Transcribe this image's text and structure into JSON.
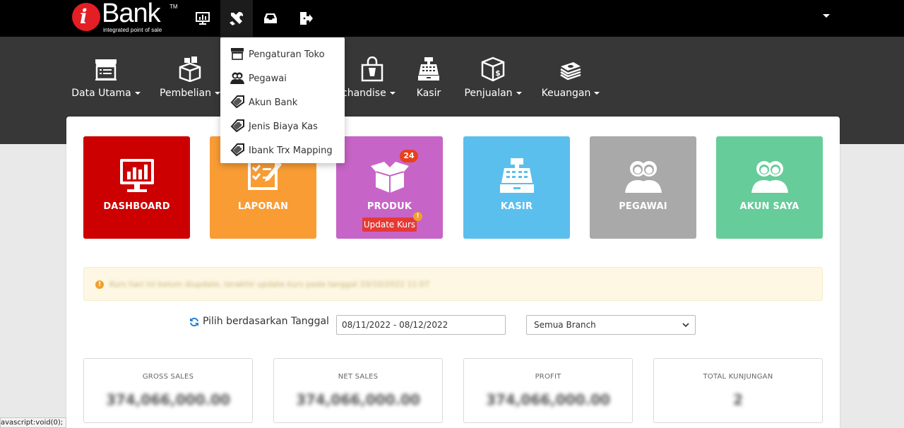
{
  "brand": {
    "name": "Bank",
    "tm": "TM",
    "tagline": "integrated point of sale"
  },
  "topbar": {
    "icons": [
      "monitor-chart-icon",
      "tools-icon",
      "inbox-icon",
      "logout-icon"
    ],
    "active": "tools-icon"
  },
  "menu": [
    {
      "label": "Data Utama",
      "icon": "store-icon",
      "caret": true
    },
    {
      "label": "Pembelian",
      "icon": "boxes-icon",
      "caret": true
    },
    {
      "label": "chandise",
      "icon": "shopping-bag-icon",
      "caret": true
    },
    {
      "label": "Kasir",
      "icon": "cash-register-icon",
      "caret": false
    },
    {
      "label": "Penjualan",
      "icon": "dollar-box-icon",
      "caret": true
    },
    {
      "label": "Keuangan",
      "icon": "money-stack-icon",
      "caret": true
    }
  ],
  "dropdown": {
    "items": [
      {
        "label": "Pengaturan Toko",
        "icon": "store-icon"
      },
      {
        "label": "Pegawai",
        "icon": "people-icon"
      },
      {
        "label": "Akun Bank",
        "icon": "tag-icon"
      },
      {
        "label": "Jenis Biaya Kas",
        "icon": "tag-icon"
      },
      {
        "label": "Ibank Trx Mapping",
        "icon": "tag-icon"
      }
    ]
  },
  "tiles": [
    {
      "label": "DASHBOARD",
      "color": "#cc0000",
      "icon": "dashboard-chart-icon"
    },
    {
      "label": "LAPORAN",
      "color": "#f99c34",
      "icon": "report-checklist-icon"
    },
    {
      "label": "PRODUK",
      "color": "#c764c7",
      "icon": "open-box-icon",
      "badge": "24",
      "extra_button": "Update Kurs",
      "warn": "!"
    },
    {
      "label": "KASIR",
      "color": "#5bbfee",
      "icon": "cash-register-icon"
    },
    {
      "label": "PEGAWAI",
      "color": "#a9a9a9",
      "icon": "people-icon"
    },
    {
      "label": "AKUN SAYA",
      "color": "#66cc99",
      "icon": "people-icon"
    }
  ],
  "alert": {
    "icon": "warning-icon",
    "mark": "!",
    "text": "Kurs hari ini belum diupdate, terakhir update kurs pada tanggal 10/10/2022 11:07"
  },
  "filter": {
    "label": "Pilih berdasarkan Tanggal",
    "date_range": "08/11/2022 - 08/12/2022",
    "branch_selected": "Semua Branch"
  },
  "stats": [
    {
      "label": "GROSS SALES",
      "value": "374,066,000.00"
    },
    {
      "label": "NET SALES",
      "value": "374,066,000.00"
    },
    {
      "label": "PROFIT",
      "value": "374,066,000.00"
    },
    {
      "label": "TOTAL KUNJUNGAN",
      "value": "2"
    }
  ],
  "statusbar": {
    "text": "avascript:void(0);"
  }
}
